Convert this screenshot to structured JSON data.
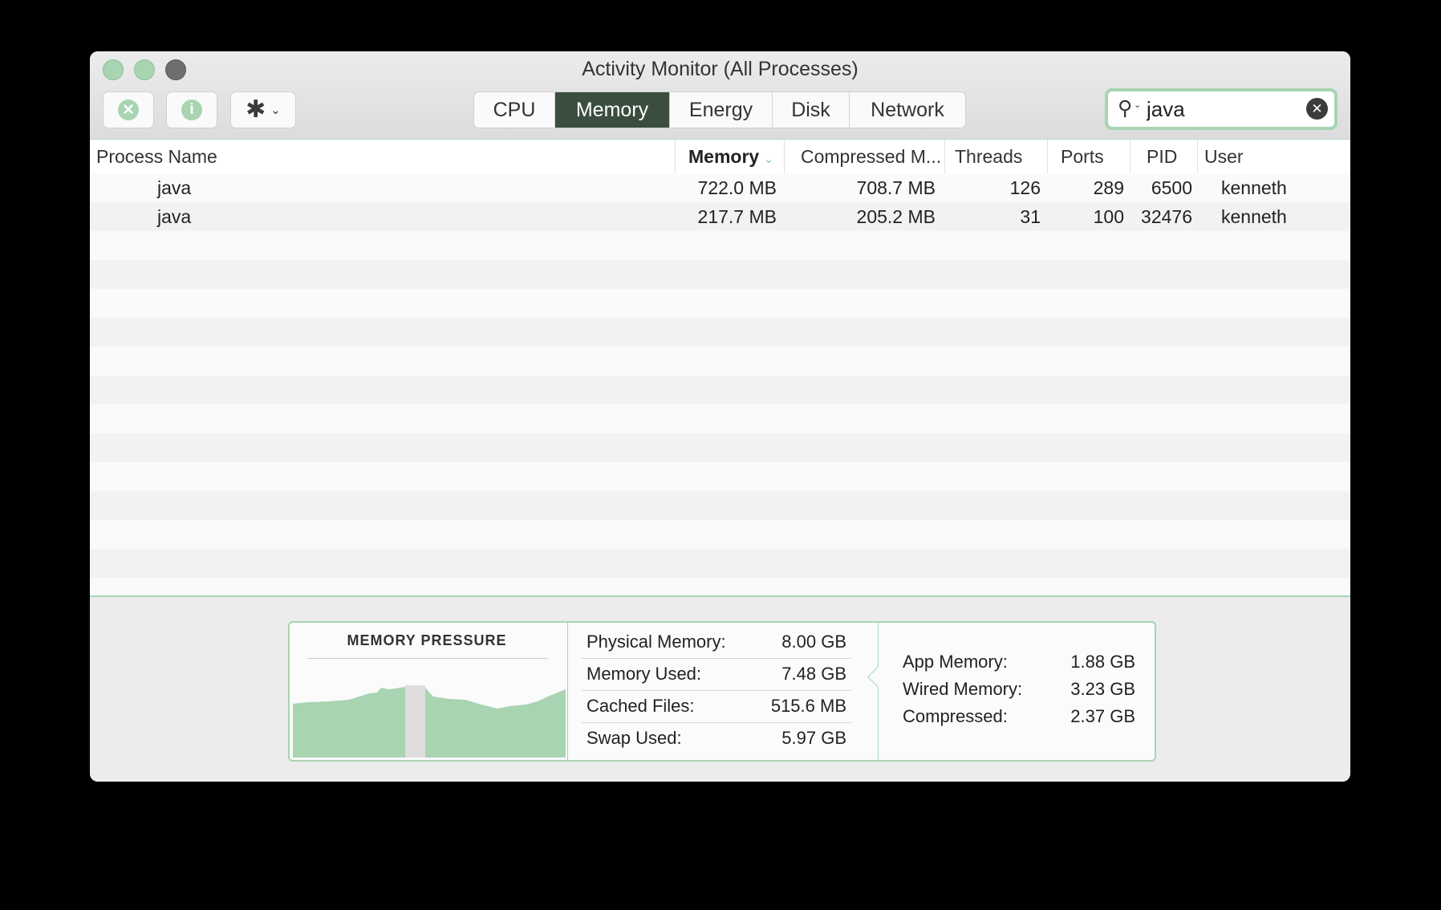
{
  "window": {
    "title": "Activity Monitor (All Processes)"
  },
  "toolbar": {
    "stop_icon": "x-mark",
    "info_icon": "i",
    "gear_icon": "✱",
    "chevron": "⌄",
    "tabs": [
      {
        "label": "CPU",
        "active": false
      },
      {
        "label": "Memory",
        "active": true
      },
      {
        "label": "Energy",
        "active": false
      },
      {
        "label": "Disk",
        "active": false
      },
      {
        "label": "Network",
        "active": false
      }
    ],
    "search": {
      "value": "java",
      "placeholder": "Search"
    }
  },
  "table": {
    "columns": {
      "process_name": "Process Name",
      "memory": "Memory",
      "compressed": "Compressed M...",
      "threads": "Threads",
      "ports": "Ports",
      "pid": "PID",
      "user": "User"
    },
    "sort_chevron": "⌄",
    "rows": [
      {
        "name": "java",
        "memory": "722.0 MB",
        "compressed": "708.7 MB",
        "threads": "126",
        "ports": "289",
        "pid": "6500",
        "user": "kenneth"
      },
      {
        "name": "java",
        "memory": "217.7 MB",
        "compressed": "205.2 MB",
        "threads": "31",
        "ports": "100",
        "pid": "32476",
        "user": "kenneth"
      }
    ]
  },
  "memory_panel": {
    "pressure_title": "MEMORY PRESSURE",
    "stats": [
      {
        "label": "Physical Memory:",
        "value": "8.00 GB"
      },
      {
        "label": "Memory Used:",
        "value": "7.48 GB"
      },
      {
        "label": "Cached Files:",
        "value": "515.6 MB"
      },
      {
        "label": "Swap Used:",
        "value": "5.97 GB"
      }
    ],
    "breakdown": [
      {
        "label": "App Memory:",
        "value": "1.88 GB"
      },
      {
        "label": "Wired Memory:",
        "value": "3.23 GB"
      },
      {
        "label": "Compressed:",
        "value": "2.37 GB"
      }
    ],
    "colors": {
      "pressure_fill": "#a8d4b1",
      "accent": "#a8d4b1",
      "active_tab": "#3a4d3f"
    }
  }
}
